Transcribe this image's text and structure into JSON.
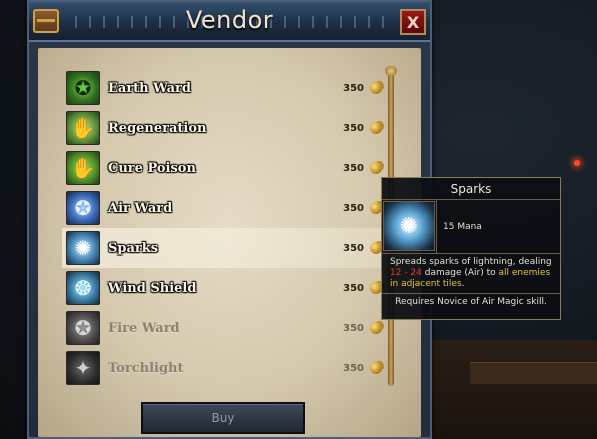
{
  "window": {
    "title": "Vendor",
    "close_glyph": "X"
  },
  "items": [
    {
      "name": "Earth Ward",
      "price": "350",
      "icon": "pentagram-icon",
      "glyph": "✪",
      "state": "available"
    },
    {
      "name": "Regeneration",
      "price": "350",
      "icon": "healing-hand-icon",
      "glyph": "✋",
      "state": "available"
    },
    {
      "name": "Cure Poison",
      "price": "350",
      "icon": "cure-hand-icon",
      "glyph": "✋",
      "state": "available"
    },
    {
      "name": "Air Ward",
      "price": "350",
      "icon": "air-pentagram-icon",
      "glyph": "✪",
      "state": "available"
    },
    {
      "name": "Sparks",
      "price": "350",
      "icon": "sparks-icon",
      "glyph": "✺",
      "state": "selected"
    },
    {
      "name": "Wind Shield",
      "price": "350",
      "icon": "wind-shield-icon",
      "glyph": "❂",
      "state": "available"
    },
    {
      "name": "Fire Ward",
      "price": "350",
      "icon": "fire-ward-icon",
      "glyph": "✪",
      "state": "disabled"
    },
    {
      "name": "Torchlight",
      "price": "350",
      "icon": "torchlight-icon",
      "glyph": "✦",
      "state": "disabled"
    }
  ],
  "buy_button": {
    "label": "Buy"
  },
  "tooltip": {
    "title": "Sparks",
    "icon_glyph": "✺",
    "mana": "15 Mana",
    "desc_1": "Spreads sparks of lightning, dealing ",
    "damage_range": "12 - 24",
    "desc_2": " damage (Air) to ",
    "targets": "all enemies in adjacent tiles",
    "desc_3": ".",
    "requirement": "Requires Novice of Air Magic skill."
  },
  "colors": {
    "damage": "#e0402a",
    "highlight": "#e8c23a",
    "window_frame": "#2b3748",
    "parchment": "#e6dcc7"
  }
}
